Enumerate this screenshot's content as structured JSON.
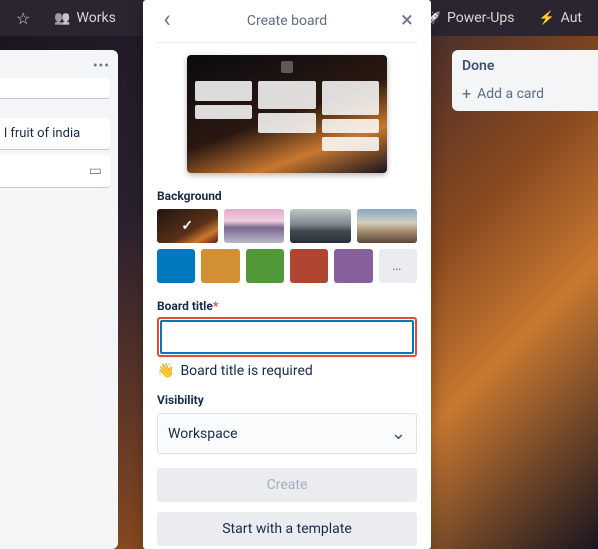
{
  "topbar": {
    "workspace_label": "Works",
    "powerups_label": "Power-Ups",
    "automation_label": "Aut"
  },
  "background_board": {
    "left_card_text": "l fruit of india",
    "done_title": "Done",
    "add_card_label": "Add a card"
  },
  "modal": {
    "title": "Create board",
    "background_label": "Background",
    "more_label": "…",
    "board_title_label": "Board title",
    "required_mark": "*",
    "board_title_value": "",
    "error_text": "Board title is required",
    "visibility_label": "Visibility",
    "visibility_value": "Workspace",
    "create_button": "Create",
    "template_button": "Start with a template",
    "colors": {
      "blue": "#0079bf",
      "orange": "#d29034",
      "green": "#519839",
      "red": "#b04632",
      "purple": "#89609e"
    }
  }
}
